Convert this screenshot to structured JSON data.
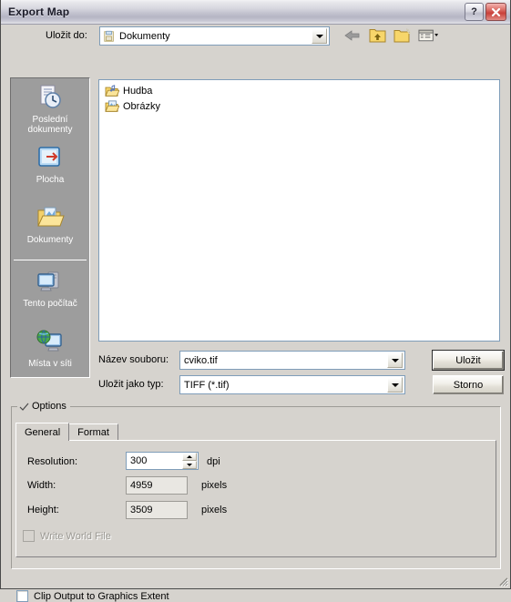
{
  "window": {
    "title": "Export Map",
    "help_button": "?",
    "close_button": "×"
  },
  "lookin": {
    "label": "Uložit do:",
    "value": "Dokumenty",
    "icon": "folder-documents-icon"
  },
  "toolbar": {
    "back": "back-arrow-icon",
    "up": "up-one-level-icon",
    "new_folder": "new-folder-icon",
    "views": "views-menu-icon"
  },
  "places": {
    "items": [
      {
        "label": "Poslední\ndokumenty",
        "icon": "recent-documents-icon"
      },
      {
        "label": "Plocha",
        "icon": "desktop-icon"
      },
      {
        "label": "Dokumenty",
        "icon": "my-documents-icon"
      },
      {
        "label": "Tento počítač",
        "icon": "my-computer-icon"
      },
      {
        "label": "Místa v síti",
        "icon": "network-places-icon"
      }
    ]
  },
  "filelist": {
    "items": [
      {
        "name": "Hudba",
        "icon": "folder-music-icon"
      },
      {
        "name": "Obrázky",
        "icon": "folder-pictures-icon"
      }
    ]
  },
  "filename": {
    "label": "Název souboru:",
    "value": "cviko.tif"
  },
  "filetype": {
    "label": "Uložit jako typ:",
    "value": "TIFF (*.tif)"
  },
  "buttons": {
    "save": "Uložit",
    "cancel": "Storno"
  },
  "options": {
    "legend": "Options",
    "tabs": [
      {
        "label": "General",
        "active": true
      },
      {
        "label": "Format",
        "active": false
      }
    ],
    "fields": [
      {
        "label": "Resolution:",
        "value": "300",
        "unit": "dpi",
        "readonly": false,
        "spinner": true
      },
      {
        "label": "Width:",
        "value": "4959",
        "unit": "pixels",
        "readonly": true,
        "spinner": false
      },
      {
        "label": "Height:",
        "value": "3509",
        "unit": "pixels",
        "readonly": true,
        "spinner": false
      }
    ],
    "write_world_file": {
      "label": "Write World File",
      "checked": false,
      "disabled": true
    }
  },
  "clip_output": {
    "label": "Clip Output to Graphics Extent",
    "checked": false
  },
  "colors": {
    "dialog_face": "#d6d3ce",
    "field_bg": "#ffffff",
    "field_border": "#7f9db9",
    "places_bg": "#9d9d9d",
    "close_red": "#c9403a",
    "folder_yellow": "#f5d66a"
  }
}
